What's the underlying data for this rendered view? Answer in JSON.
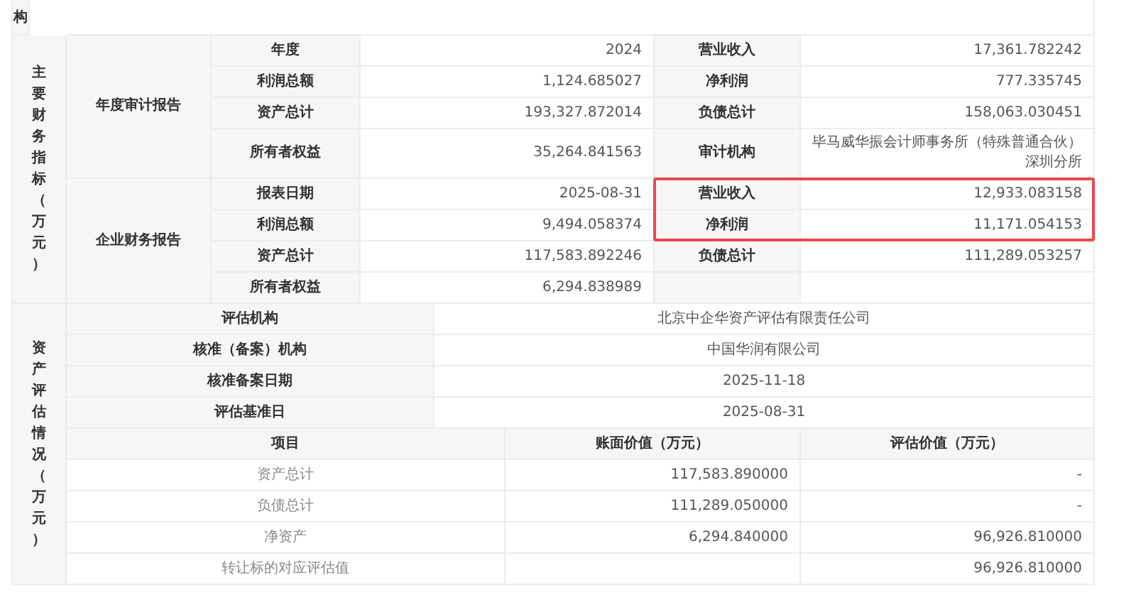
{
  "top_row": {
    "section_label": "构"
  },
  "financial_indicators": {
    "section_label": "主要财务指标（万元）",
    "groups": [
      {
        "title": "年度审计报告",
        "rows": [
          {
            "label_1": "年度",
            "value_1": "2024",
            "label_2": "营业收入",
            "value_2": "17,361.782242",
            "highlighted": false
          },
          {
            "label_1": "利润总额",
            "value_1": "1,124.685027",
            "label_2": "净利润",
            "value_2": "777.335745",
            "highlighted": false
          },
          {
            "label_1": "资产总计",
            "value_1": "193,327.872014",
            "label_2": "负债总计",
            "value_2": "158,063.030451",
            "highlighted": false
          },
          {
            "label_1": "所有者权益",
            "value_1": "35,264.841563",
            "label_2": "审计机构",
            "value_2": "毕马威华振会计师事务所（特殊普通合伙）深圳分所",
            "highlighted": false
          }
        ]
      },
      {
        "title": "企业财务报告",
        "rows": [
          {
            "label_1": "报表日期",
            "value_1": "2025-08-31",
            "label_2": "营业收入",
            "value_2": "12,933.083158",
            "highlighted": true
          },
          {
            "label_1": "利润总额",
            "value_1": "9,494.058374",
            "label_2": "净利润",
            "value_2": "11,171.054153",
            "highlighted": true
          },
          {
            "label_1": "资产总计",
            "value_1": "117,583.892246",
            "label_2": "负债总计",
            "value_2": "111,289.053257",
            "highlighted": false
          },
          {
            "label_1": "所有者权益",
            "value_1": "6,294.838989",
            "highlighted": false
          }
        ]
      }
    ]
  },
  "asset_valuation": {
    "section_label": "资产评估情况（万元）",
    "info_rows": [
      {
        "label": "评估机构",
        "value": "北京中企华资产评估有限责任公司"
      },
      {
        "label": "核准（备案）机构",
        "value": "中国华润有限公司"
      },
      {
        "label": "核准备案日期",
        "value": "2025-11-18"
      },
      {
        "label": "评估基准日",
        "value": "2025-08-31"
      }
    ],
    "columns": [
      "项目",
      "账面价值（万元）",
      "评估价值（万元）"
    ],
    "rows": [
      [
        "资产总计",
        "117,583.890000",
        "-"
      ],
      [
        "负债总计",
        "111,289.050000",
        "-"
      ],
      [
        "净资产",
        "6,294.840000",
        "96,926.810000"
      ],
      [
        "转让标的对应评估值",
        "",
        "96,926.810000"
      ]
    ]
  }
}
